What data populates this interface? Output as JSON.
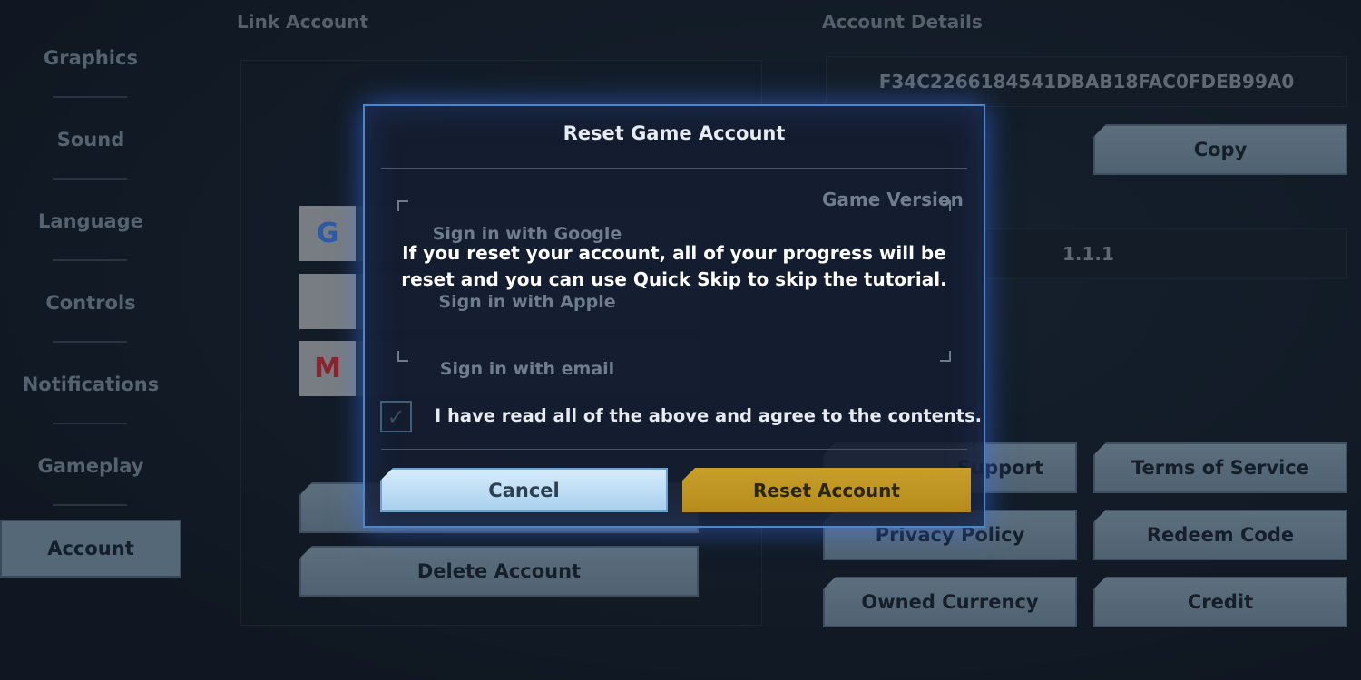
{
  "sidebar": {
    "items": [
      {
        "label": "Graphics"
      },
      {
        "label": "Sound"
      },
      {
        "label": "Language"
      },
      {
        "label": "Controls"
      },
      {
        "label": "Notifications"
      },
      {
        "label": "Gameplay"
      },
      {
        "label": "Account",
        "active": true
      }
    ]
  },
  "link_account": {
    "title": "Link Account",
    "google": "Sign in with Google",
    "apple": "Sign in with Apple",
    "email": "Sign in with email",
    "delete": "Delete Account"
  },
  "account_details": {
    "title": "Account Details",
    "account_id": "F34C2266184541DBAB18FAC0FDEB99A0",
    "copy": "Copy",
    "version_label": "Game Version",
    "version": "1.1.1",
    "buttons": {
      "support": "Support",
      "terms": "Terms of Service",
      "privacy": "Privacy Policy",
      "redeem": "Redeem Code",
      "currency": "Owned Currency",
      "credit": "Credit"
    }
  },
  "modal": {
    "title": "Reset Game Account",
    "message": "If you reset your account, all of your progress will be reset and you can use Quick Skip to skip the tutorial.",
    "agree": "I have read all of the above and agree to the contents.",
    "agree_checked": false,
    "cancel": "Cancel",
    "reset": "Reset Account"
  },
  "colors": {
    "accent": "#4f86c6",
    "reset_button": "#c99f2a",
    "cancel_button": "#b9dcf4"
  }
}
